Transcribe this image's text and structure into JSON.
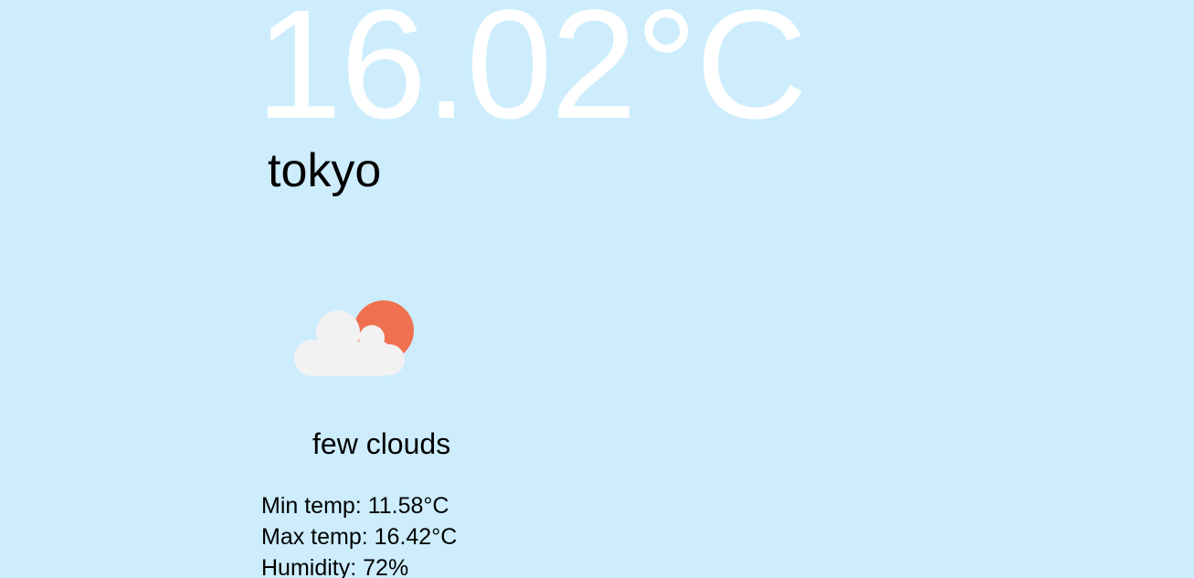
{
  "weather": {
    "temperature": "16.02°C",
    "city": "tokyo",
    "icon": "few-clouds-icon",
    "description": "few clouds",
    "details": {
      "min_temp": "Min temp: 11.58°C",
      "max_temp": "Max temp: 16.42°C",
      "humidity": "Humidity: 72%"
    }
  },
  "colors": {
    "background": "#cdedfd",
    "temperature_text": "#ffffff",
    "sun": "#ef7150",
    "cloud": "#f2f2f2"
  }
}
